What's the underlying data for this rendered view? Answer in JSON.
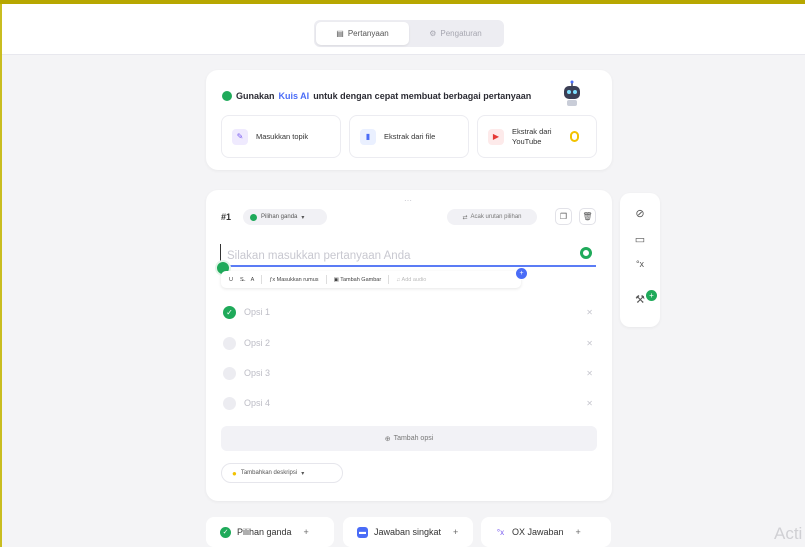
{
  "tabs": [
    {
      "label": "Pertanyaan",
      "icon": "document-icon",
      "active": true
    },
    {
      "label": "Pengaturan",
      "icon": "settings-icon",
      "active": false
    }
  ],
  "ai_panel": {
    "title_prefix": "Gunakan",
    "title_highlight": "Kuis AI",
    "title_suffix": "untuk dengan cepat membuat berbagai pertanyaan",
    "buttons": [
      {
        "label": "Masukkan topik",
        "icon": "pencil-icon",
        "color": "#7a5cf0"
      },
      {
        "label": "Ekstrak dari file",
        "icon": "file-icon",
        "color": "#4a6cf7"
      },
      {
        "label": "Ekstrak dari YouTube",
        "icon": "youtube-icon",
        "color": "#e53935"
      }
    ]
  },
  "question": {
    "number": "#1",
    "type_label": "Pilihan ganda",
    "shuffle_label": "Acak urutan pilihan",
    "placeholder": "Silakan masukkan pertanyaan Anda",
    "toolbar": {
      "formula_label": "Masukkan rumus",
      "image_label": "Tambah Gambar",
      "audio_label": "Add audio"
    },
    "options": [
      {
        "label": "Opsi 1",
        "correct": true
      },
      {
        "label": "Opsi 2",
        "correct": false
      },
      {
        "label": "Opsi 3",
        "correct": false
      },
      {
        "label": "Opsi 4",
        "correct": false
      }
    ],
    "add_option_label": "Tambah opsi",
    "description_label": "Tambahkan deskripsi"
  },
  "bottom_buttons": [
    {
      "label": "Pilihan ganda",
      "icon": "check-circle-icon",
      "color": "#1faa5a"
    },
    {
      "label": "Jawaban singkat",
      "icon": "chat-icon",
      "color": "#4a6cf7"
    },
    {
      "label": "OX Jawaban",
      "icon": "ox-icon",
      "color": "#7a5cf0"
    }
  ],
  "watermark": "Acti",
  "colors": {
    "accent": "#4a6cf7",
    "success": "#1faa5a",
    "brand_bar": "#b7a700"
  }
}
